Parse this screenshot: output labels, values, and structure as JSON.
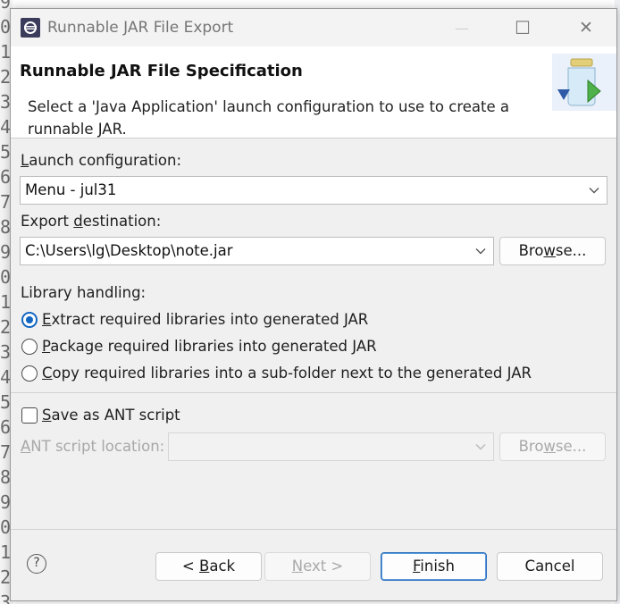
{
  "window": {
    "title": "Runnable JAR File Export",
    "minimize_glyph": "—",
    "maximize_glyph": "☐",
    "close_glyph": "✕"
  },
  "header": {
    "title": "Runnable JAR File Specification",
    "description": "Select a 'Java Application' launch configuration to use to create a runnable JAR."
  },
  "launch": {
    "label_prefix": "",
    "label_mnemonic": "L",
    "label_rest": "aunch configuration:",
    "value": "Menu - jul31"
  },
  "export": {
    "label_prefix": "Export ",
    "label_mnemonic": "d",
    "label_rest": "estination:",
    "value": "C:\\Users\\lg\\Desktop\\note.jar",
    "browse_prefix": "Bro",
    "browse_mnemonic": "w",
    "browse_rest": "se..."
  },
  "library": {
    "label": "Library handling:",
    "options": [
      {
        "mnemonic": "E",
        "rest": "xtract required libraries into generated JAR",
        "checked": true
      },
      {
        "mnemonic": "P",
        "rest": "ackage required libraries into generated JAR",
        "checked": false
      },
      {
        "mnemonic": "C",
        "rest": "opy required libraries into a sub-folder next to the generated JAR",
        "checked": false
      }
    ]
  },
  "ant": {
    "save_mnemonic": "S",
    "save_rest": "ave as ANT script",
    "location_mnemonic": "A",
    "location_rest": "NT script location:",
    "location_value": "",
    "browse_prefix": "Bro",
    "browse_mnemonic": "w",
    "browse_rest": "se..."
  },
  "footer": {
    "help_glyph": "?",
    "back_prefix": "< ",
    "back_mnemonic": "B",
    "back_rest": "ack",
    "next_mnemonic": "N",
    "next_rest": "ext >",
    "finish_mnemonic": "F",
    "finish_rest": "inish",
    "cancel_label": "Cancel"
  },
  "background": {
    "gutter_digits": [
      "9",
      "0",
      "1",
      "2",
      "3",
      "4",
      "5",
      "6",
      "7",
      "8",
      "9",
      "0",
      "1",
      "2",
      "3",
      "4",
      "5",
      "6",
      "7",
      "8",
      "9",
      "0",
      "1",
      "2",
      "3"
    ]
  },
  "colors": {
    "accent": "#1366c2",
    "dialog_bg": "#f0f0f0",
    "header_bg": "#ffffff"
  }
}
